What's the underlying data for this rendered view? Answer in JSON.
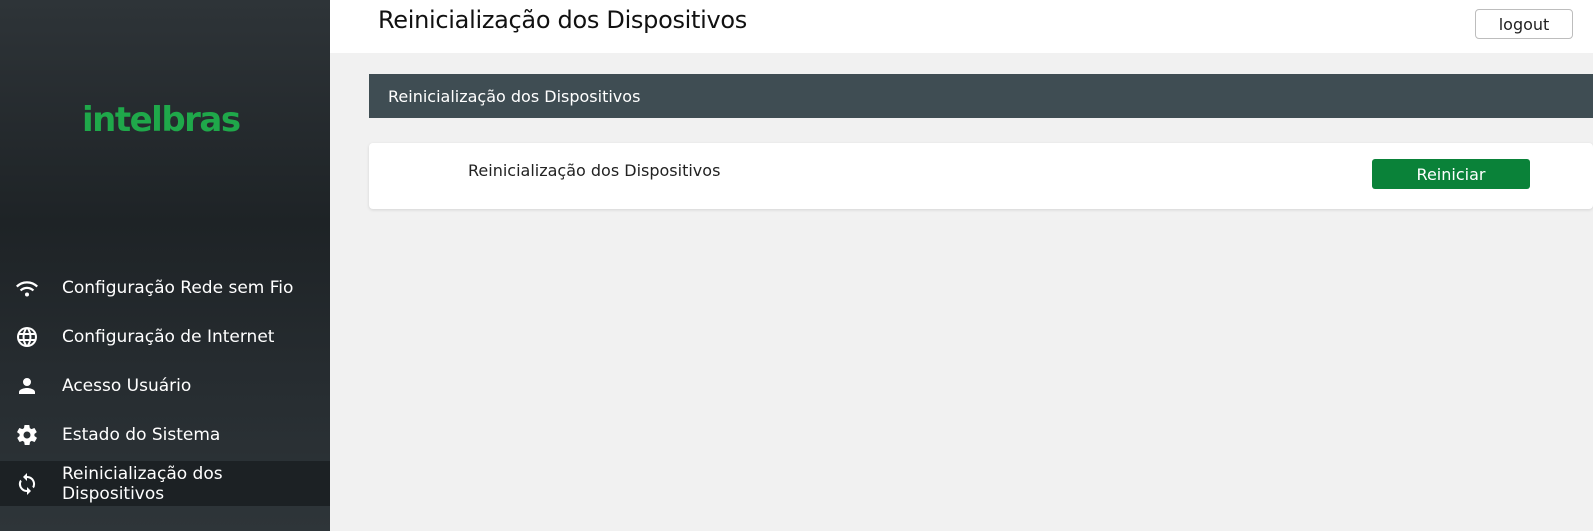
{
  "brand": {
    "logo_text": "intelbras",
    "logo_color": "#1fa84a"
  },
  "sidebar": {
    "items": [
      {
        "label": "Configuração Rede sem Fio",
        "icon": "wifi-icon"
      },
      {
        "label": "Configuração de Internet",
        "icon": "globe-icon"
      },
      {
        "label": "Acesso Usuário",
        "icon": "user-icon"
      },
      {
        "label": "Estado do Sistema",
        "icon": "gear-icon"
      },
      {
        "label": "Reinicialização dos Dispositivos",
        "icon": "refresh-icon",
        "active": true
      }
    ]
  },
  "header": {
    "title": "Reinicialização dos Dispositivos",
    "logout_label": "logout"
  },
  "main": {
    "section_title": "Reinicialização dos Dispositivos",
    "reboot_row_label": "Reinicialização dos Dispositivos",
    "reboot_button_label": "Reiniciar",
    "reboot_button_color": "#0a8239"
  }
}
